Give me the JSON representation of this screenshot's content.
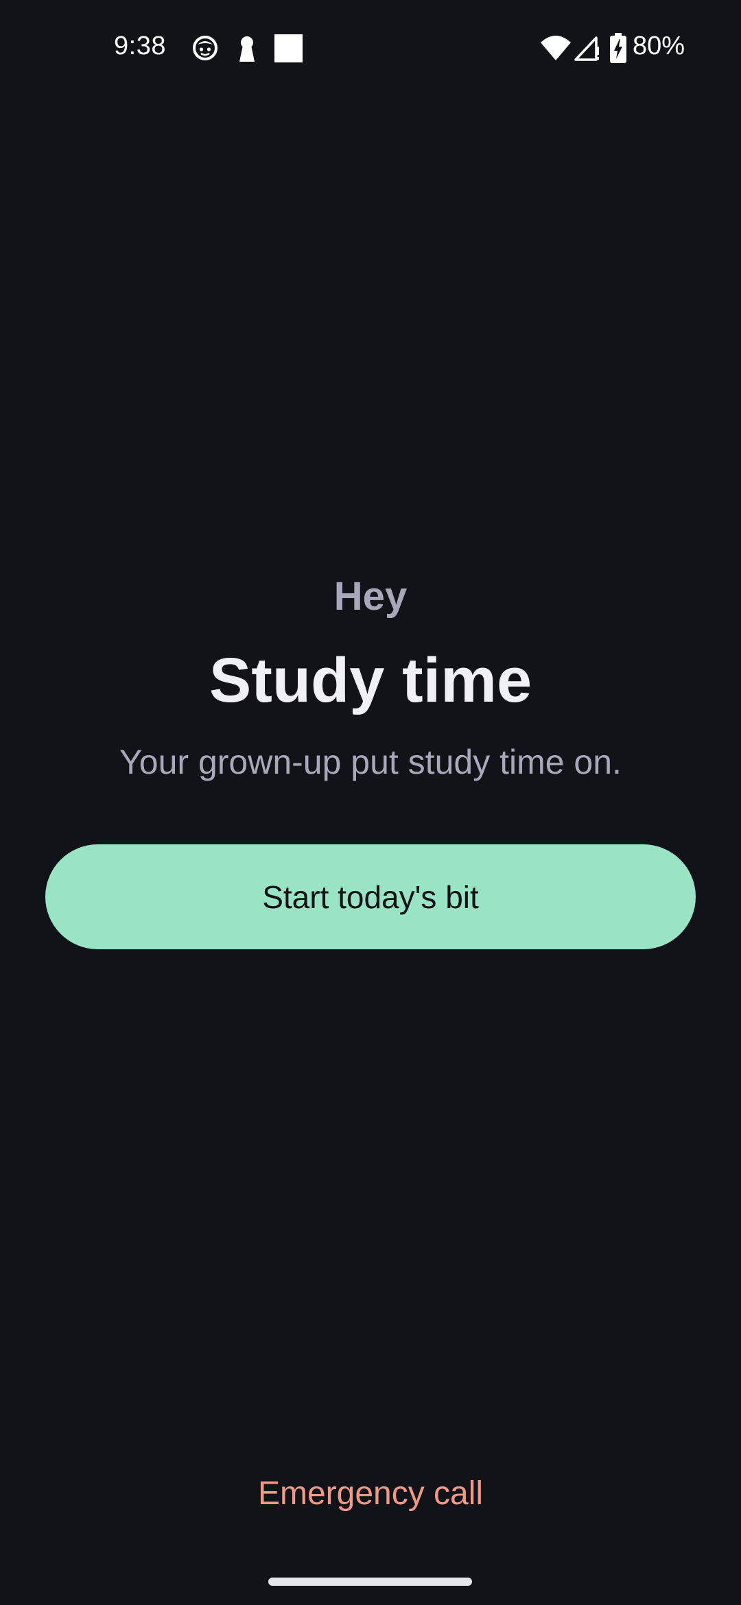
{
  "status_bar": {
    "time": "9:38",
    "battery_percent": "80%",
    "icons": [
      "notification-face-icon",
      "keyhole-icon",
      "square-notification-icon",
      "wifi-icon",
      "cell-signal-icon",
      "battery-charging-icon"
    ]
  },
  "main": {
    "greeting": "Hey",
    "title": "Study time",
    "subtitle": "Your grown-up put study time on.",
    "start_button_label": "Start today's bit"
  },
  "footer": {
    "emergency_call_label": "Emergency call"
  },
  "colors": {
    "background": "#121318",
    "accent_button": "#98e4c4",
    "emergency_text": "#ef9a88",
    "muted_text": "#a9a8ba",
    "title_text": "#f1f0f7"
  }
}
